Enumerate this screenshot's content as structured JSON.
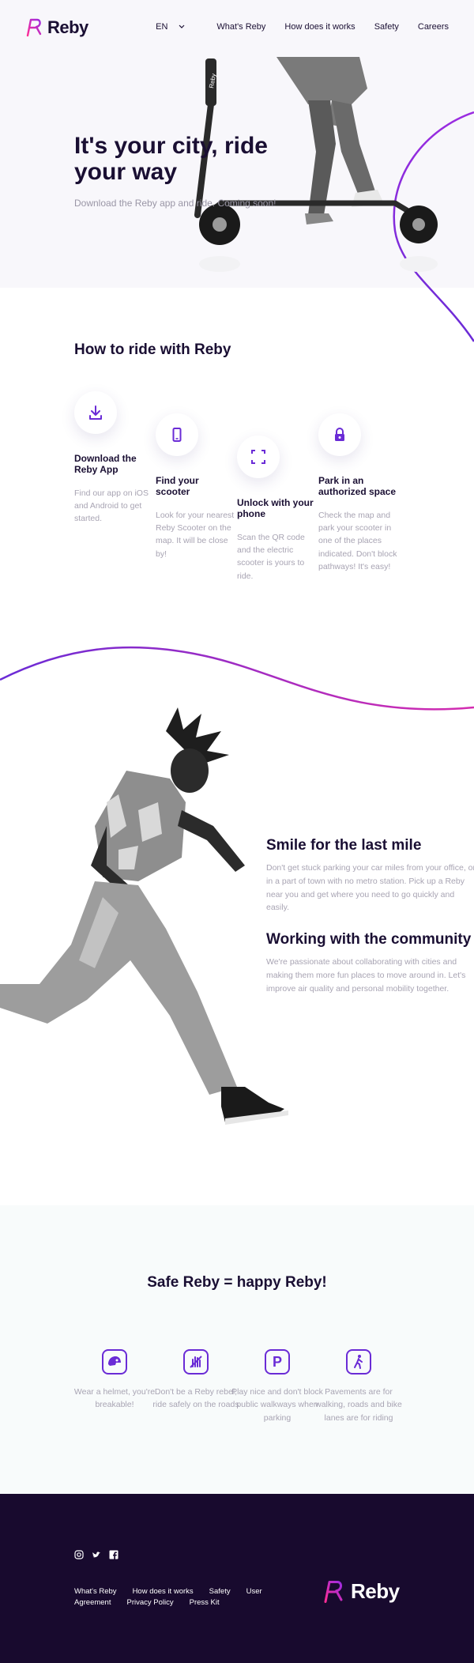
{
  "header": {
    "brand": "Reby",
    "lang": "EN",
    "nav": [
      "What's Reby",
      "How does it works",
      "Safety",
      "Careers"
    ]
  },
  "hero": {
    "title": "It's your city, ride your way",
    "subtitle": "Download the Reby app and ride. Coming soon!",
    "scooter_brand": "Reby"
  },
  "how": {
    "title": "How to ride with Reby",
    "steps": [
      {
        "icon": "download-icon",
        "title": "Download the Reby App",
        "desc": "Find our app on iOS and Android to get started."
      },
      {
        "icon": "phone-icon",
        "title": "Find your scooter",
        "desc": "Look for your nearest Reby Scooter on the map. It will be close by!"
      },
      {
        "icon": "scan-icon",
        "title": "Unlock with your phone",
        "desc": "Scan the QR code and the electric scooter is yours to ride."
      },
      {
        "icon": "lock-icon",
        "title": "Park in an authorized space",
        "desc": "Check the map and park your scooter in one of the places indicated. Don't block pathways! It's easy!"
      }
    ]
  },
  "features": [
    {
      "title": "Smile for the last mile",
      "text": "Don't get stuck parking your car miles from your office, or in a part of town with no metro station. Pick up a Reby near you and get where you need to go quickly and easily."
    },
    {
      "title": "Working with the community",
      "text": "We're passionate about collaborating with cities and making them more fun places to move around in. Let's improve air quality and personal mobility together."
    }
  ],
  "safety": {
    "title": "Safe Reby = happy Reby!",
    "items": [
      {
        "icon": "helmet-icon",
        "text": "Wear a helmet, you're breakable!"
      },
      {
        "icon": "no-rebel-icon",
        "text": "Don't be a Reby rebel, ride safely on the roads"
      },
      {
        "icon": "parking-icon",
        "glyph": "P",
        "text": "Play nice and don't block public walkways when parking"
      },
      {
        "icon": "pedestrian-icon",
        "text": "Pavements are for walking, roads and bike lanes are for riding"
      }
    ]
  },
  "footer": {
    "links": [
      "What's Reby",
      "How does it works",
      "Safety",
      "User Agreement",
      "Privacy Policy",
      "Press Kit"
    ],
    "brand": "Reby"
  },
  "colors": {
    "accent": "#6a2bd6",
    "brand_gradient": [
      "#ff2d95",
      "#6a2bd6"
    ],
    "dark": "#180a2e"
  }
}
